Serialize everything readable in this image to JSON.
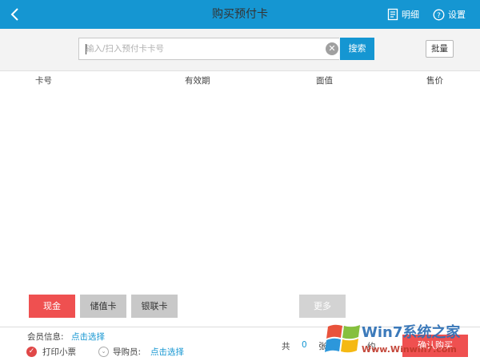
{
  "header": {
    "title": "购买预付卡",
    "detail_label": "明细",
    "settings_label": "设置"
  },
  "search": {
    "placeholder": "输入/扫入预付卡卡号",
    "value": "",
    "search_label": "搜索",
    "batch_label": "批量"
  },
  "table": {
    "columns": [
      "卡号",
      "有效期",
      "面值",
      "售价"
    ],
    "rows": []
  },
  "payment": {
    "cash": "现金",
    "stored_value": "储值卡",
    "union_pay": "银联卡",
    "more": "更多"
  },
  "footer": {
    "member_label": "会员信息:",
    "member_link": "点击选择",
    "print_label": "打印小票",
    "guide_label": "导购员:",
    "guide_link": "点击选择",
    "total_prefix": "共",
    "total_count": "0",
    "total_unit": "张",
    "amount_prefix": "约",
    "confirm_label": "确认购买"
  },
  "watermark": {
    "brand": "Win7系统之家",
    "url": "Www.Winwin7.com"
  },
  "colors": {
    "primary": "#1596d2",
    "danger": "#ef5050"
  }
}
